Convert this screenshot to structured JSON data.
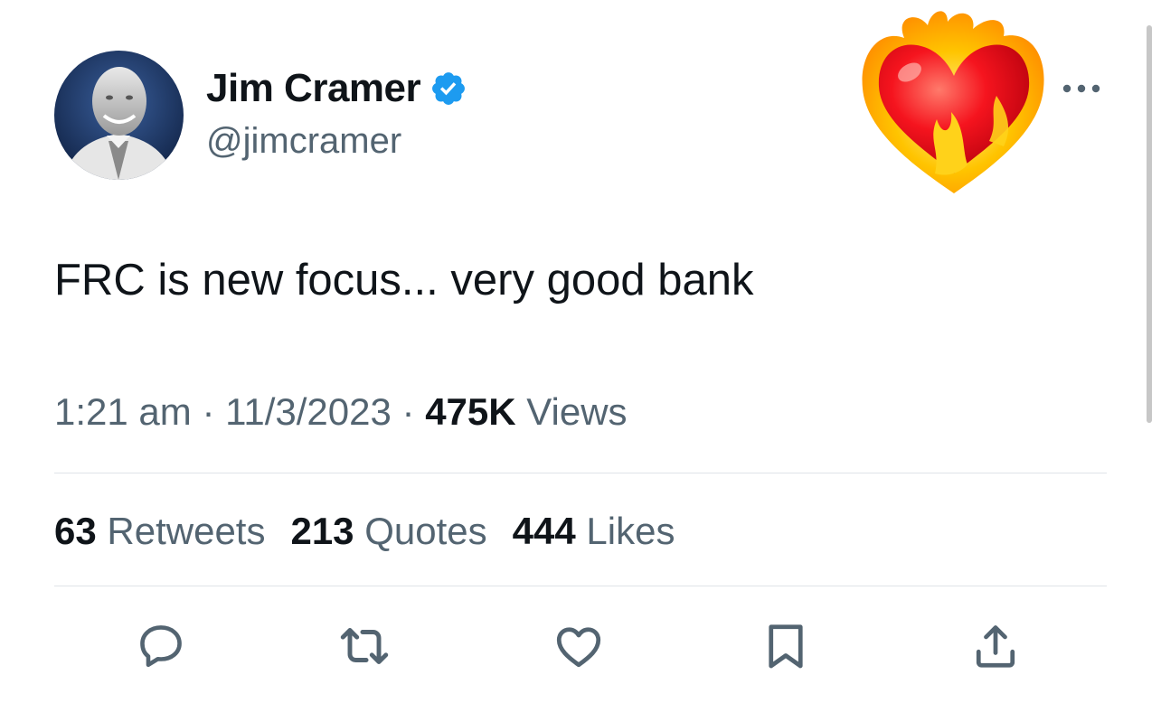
{
  "author": {
    "name": "Jim Cramer",
    "handle": "@jimcramer",
    "verified": true
  },
  "tweet": {
    "text": "FRC is new focus... very good bank",
    "time": "1:21 am",
    "date": "11/3/2023",
    "views_count": "475K",
    "views_label": "Views"
  },
  "separator": "·",
  "stats": {
    "retweets_count": "63",
    "retweets_label": "Retweets",
    "quotes_count": "213",
    "quotes_label": "Quotes",
    "likes_count": "444",
    "likes_label": "Likes"
  },
  "icons": {
    "more": "more-icon",
    "reply": "reply-icon",
    "retweet": "retweet-icon",
    "like": "heart-icon",
    "bookmark": "bookmark-icon",
    "share": "share-icon",
    "verified": "verified-badge-icon",
    "emoji": "heart-on-fire-emoji"
  },
  "colors": {
    "text_primary": "#0f1419",
    "text_secondary": "#536471",
    "verified_blue": "#1d9bf0",
    "divider": "#dfe4e8"
  }
}
